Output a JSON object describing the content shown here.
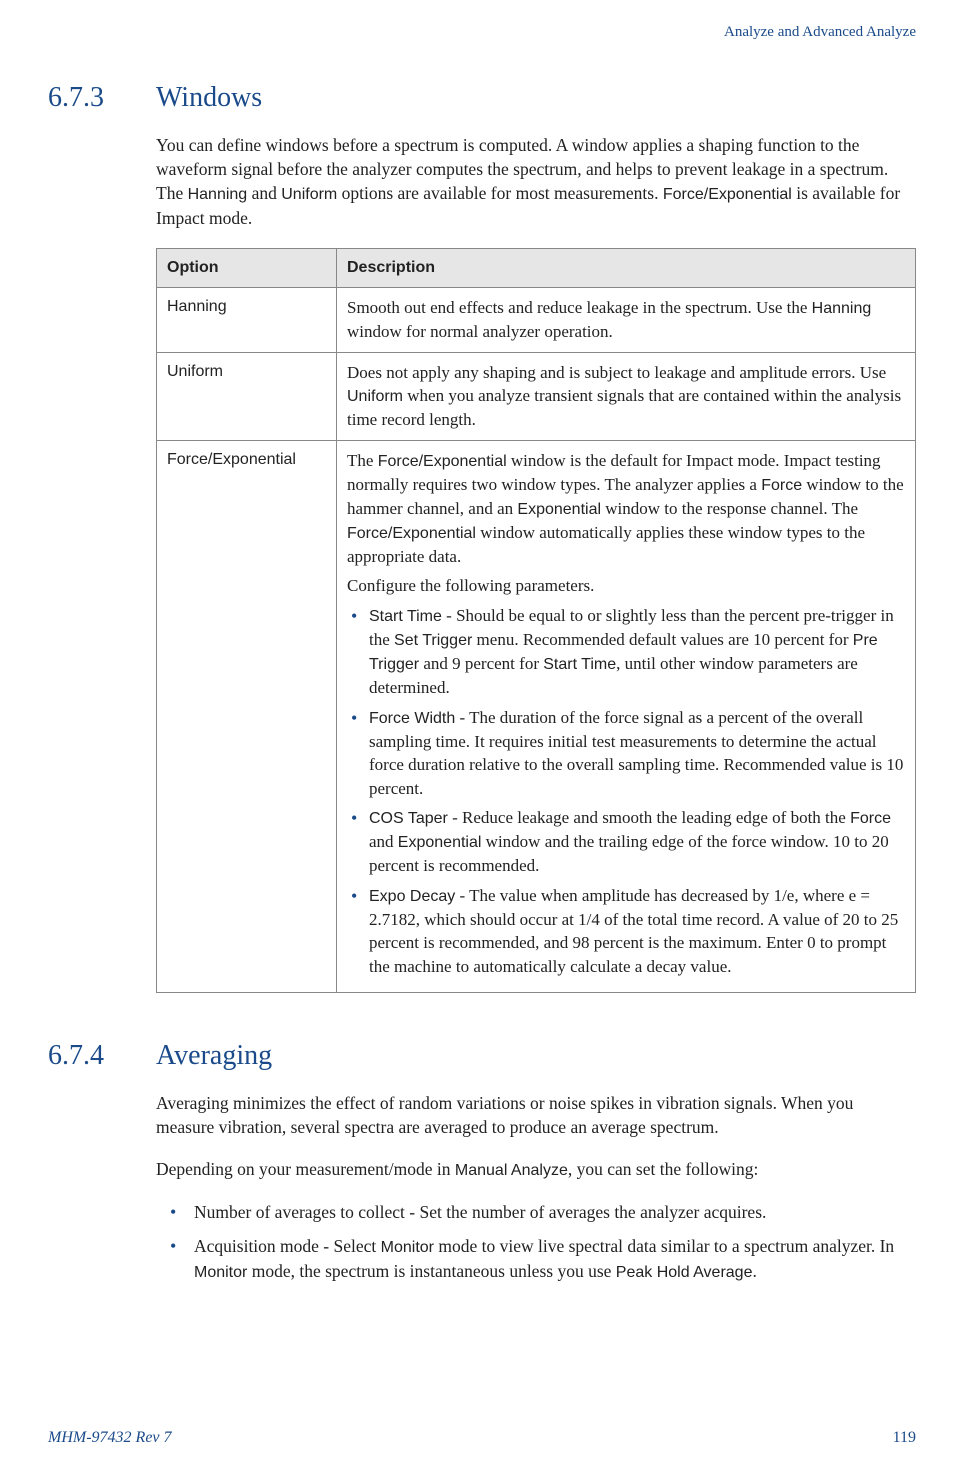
{
  "running_head": "Analyze and Advanced Analyze",
  "section_673": {
    "num": "6.7.3",
    "title": "Windows",
    "intro_parts": [
      "You can define windows before a spectrum is computed. A window applies a shaping function to the waveform signal before the analyzer computes the spectrum, and helps to prevent leakage in a spectrum. The ",
      "Hanning",
      " and ",
      "Uniform",
      " options are available for most measurements. ",
      "Force/Exponential",
      " is available for Impact mode."
    ],
    "table": {
      "head_option": "Option",
      "head_desc": "Description",
      "rows": [
        {
          "option": "Hanning",
          "desc_parts": [
            "Smooth out end effects and reduce leakage in the spectrum. Use the ",
            "Hanning",
            " window for normal analyzer operation."
          ]
        },
        {
          "option": "Uniform",
          "desc_parts": [
            "Does not apply any shaping and is subject to leakage and amplitude errors. Use ",
            "Uniform",
            " when you analyze transient signals that are contained within the analysis time record length."
          ]
        }
      ],
      "row_fe": {
        "option": "Force/Exponential",
        "p1_parts": [
          "The ",
          "Force/Exponential",
          " window is the default for Impact mode. Impact testing normally requires two window types. The analyzer applies a ",
          "Force",
          " window to the hammer channel, and an ",
          "Exponential",
          " window to the response channel. The ",
          "Force/Exponential",
          " window automatically applies these window types to the appropriate data."
        ],
        "p2": "Configure the following parameters.",
        "params": [
          {
            "name": "Start Time",
            "rest_parts": [
              " - Should be equal to or slightly less than the percent pre-trigger in the ",
              "Set Trigger",
              " menu. Recommended default values are 10 percent for ",
              "Pre Trigger",
              " and 9 percent for ",
              "Start Time",
              ", until other window parameters are determined."
            ]
          },
          {
            "name": "Force Width",
            "rest_parts": [
              " - The duration of the force signal as a percent of the overall sampling time. It requires initial test measurements to determine the actual force duration relative to the overall sampling time. Recommended value is 10 percent."
            ]
          },
          {
            "name": "COS Taper",
            "rest_parts": [
              " - Reduce leakage and smooth the leading edge of both the ",
              "Force",
              " and ",
              "Exponential",
              " window and the trailing edge of the force window. 10 to 20 percent is recommended."
            ]
          },
          {
            "name": "Expo Decay",
            "rest_parts": [
              " - The value when amplitude has decreased by 1/e, where e = 2.7182, which should occur at 1/4 of the total time record. A value of 20 to 25 percent is recommended, and 98 percent is the maximum. Enter 0 to prompt the machine to automatically calculate a decay value."
            ]
          }
        ]
      }
    }
  },
  "section_674": {
    "num": "6.7.4",
    "title": "Averaging",
    "p1": "Averaging minimizes the effect of random variations or noise spikes in vibration signals. When you measure vibration, several spectra are averaged to produce an average spectrum.",
    "p2_parts": [
      "Depending on your measurement/mode in ",
      "Manual Analyze",
      ", you can set the following:"
    ],
    "bullets": [
      {
        "parts": [
          "Number of averages to collect - Set the number of averages the analyzer acquires."
        ]
      },
      {
        "parts": [
          "Acquisition mode - Select ",
          "Monitor",
          " mode to view live spectral data similar to a spectrum analyzer. In ",
          "Monitor",
          " mode, the spectrum is instantaneous unless you use ",
          "Peak Hold Average",
          "."
        ]
      }
    ]
  },
  "footer": {
    "doc": "MHM-97432 Rev 7",
    "page": "119"
  }
}
